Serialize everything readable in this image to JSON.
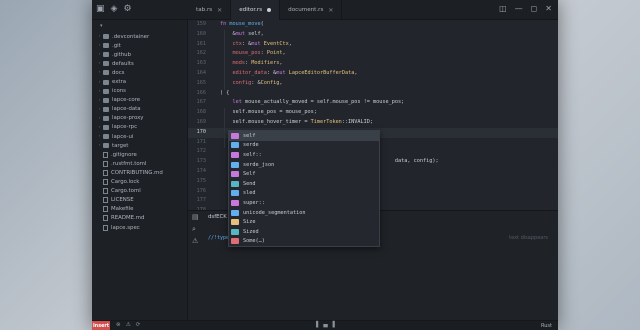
{
  "titlebar": {
    "tabs": [
      {
        "label": "tab.rs",
        "active": false,
        "modified": false
      },
      {
        "label": "editor.rs",
        "active": true,
        "modified": true
      },
      {
        "label": "document.rs",
        "active": false,
        "modified": false
      }
    ]
  },
  "sidebar": {
    "root": "lapce",
    "items": [
      {
        "label": ".devcontainer",
        "type": "dir"
      },
      {
        "label": ".git",
        "type": "dir"
      },
      {
        "label": ".github",
        "type": "dir"
      },
      {
        "label": "defaults",
        "type": "dir"
      },
      {
        "label": "docs",
        "type": "dir"
      },
      {
        "label": "extra",
        "type": "dir"
      },
      {
        "label": "icons",
        "type": "dir"
      },
      {
        "label": "lapce-core",
        "type": "dir"
      },
      {
        "label": "lapce-data",
        "type": "dir"
      },
      {
        "label": "lapce-proxy",
        "type": "dir"
      },
      {
        "label": "lapce-rpc",
        "type": "dir"
      },
      {
        "label": "lapce-ui",
        "type": "dir"
      },
      {
        "label": "target",
        "type": "dir"
      },
      {
        "label": ".gitignore",
        "type": "file"
      },
      {
        "label": ".rustfmt.toml",
        "type": "file"
      },
      {
        "label": "CONTRIBUTING.md",
        "type": "file"
      },
      {
        "label": "Cargo.lock",
        "type": "file"
      },
      {
        "label": "Cargo.toml",
        "type": "file"
      },
      {
        "label": "LICENSE",
        "type": "file"
      },
      {
        "label": "Makefile",
        "type": "file"
      },
      {
        "label": "README.md",
        "type": "file"
      },
      {
        "label": "lapce.spec",
        "type": "file"
      }
    ]
  },
  "editor": {
    "line_numbers": [
      "159",
      "160",
      "161",
      "162",
      "163",
      "164",
      "165",
      "166",
      "167",
      "168",
      "169",
      "170",
      "171",
      "172",
      "173",
      "174",
      "175",
      "176",
      "177",
      "178"
    ],
    "current_line": "170",
    "lines": [
      "fn mouse_move(",
      "    &mut self,",
      "    ctx: &mut EventCtx,",
      "    mouse_pos: Point,",
      "    mods: Modifiers,",
      "    editor_data: &mut LapceEditorBufferData,",
      "    config: &Config,",
      ") {",
      "    let mouse_actually_moved = self.mouse_pos != mouse_pos;",
      "    self.mouse_pos = mouse_pos;",
      "    self.mouse_hover_timer = TimerToken::INVALID;",
      "    se",
      "",
      "",
      "                                                        data, config);",
      "",
      "",
      "",
      "",
      ""
    ]
  },
  "completion": {
    "items": [
      {
        "label": "self",
        "kind": "keyword",
        "color": "#c678dd"
      },
      {
        "label": "serde",
        "kind": "module",
        "color": "#61afef"
      },
      {
        "label": "self::",
        "kind": "keyword",
        "color": "#c678dd"
      },
      {
        "label": "serde_json",
        "kind": "module",
        "color": "#61afef"
      },
      {
        "label": "Self",
        "kind": "keyword",
        "color": "#c678dd"
      },
      {
        "label": "Send",
        "kind": "trait",
        "color": "#56b6c2"
      },
      {
        "label": "sled",
        "kind": "module",
        "color": "#61afef"
      },
      {
        "label": "super::",
        "kind": "keyword",
        "color": "#c678dd"
      },
      {
        "label": "unicode_segmentation",
        "kind": "module",
        "color": "#61afef"
      },
      {
        "label": "Size",
        "kind": "struct",
        "color": "#e5c07b"
      },
      {
        "label": "Sized",
        "kind": "trait",
        "color": "#56b6c2"
      },
      {
        "label": "Some(…)",
        "kind": "enum-member",
        "color": "#e06c75"
      }
    ]
  },
  "panel": {
    "title": "dsfECK",
    "line": "//!types",
    "hint": "text disappears"
  },
  "statusbar": {
    "mode": "Insert",
    "language": "Rust"
  }
}
